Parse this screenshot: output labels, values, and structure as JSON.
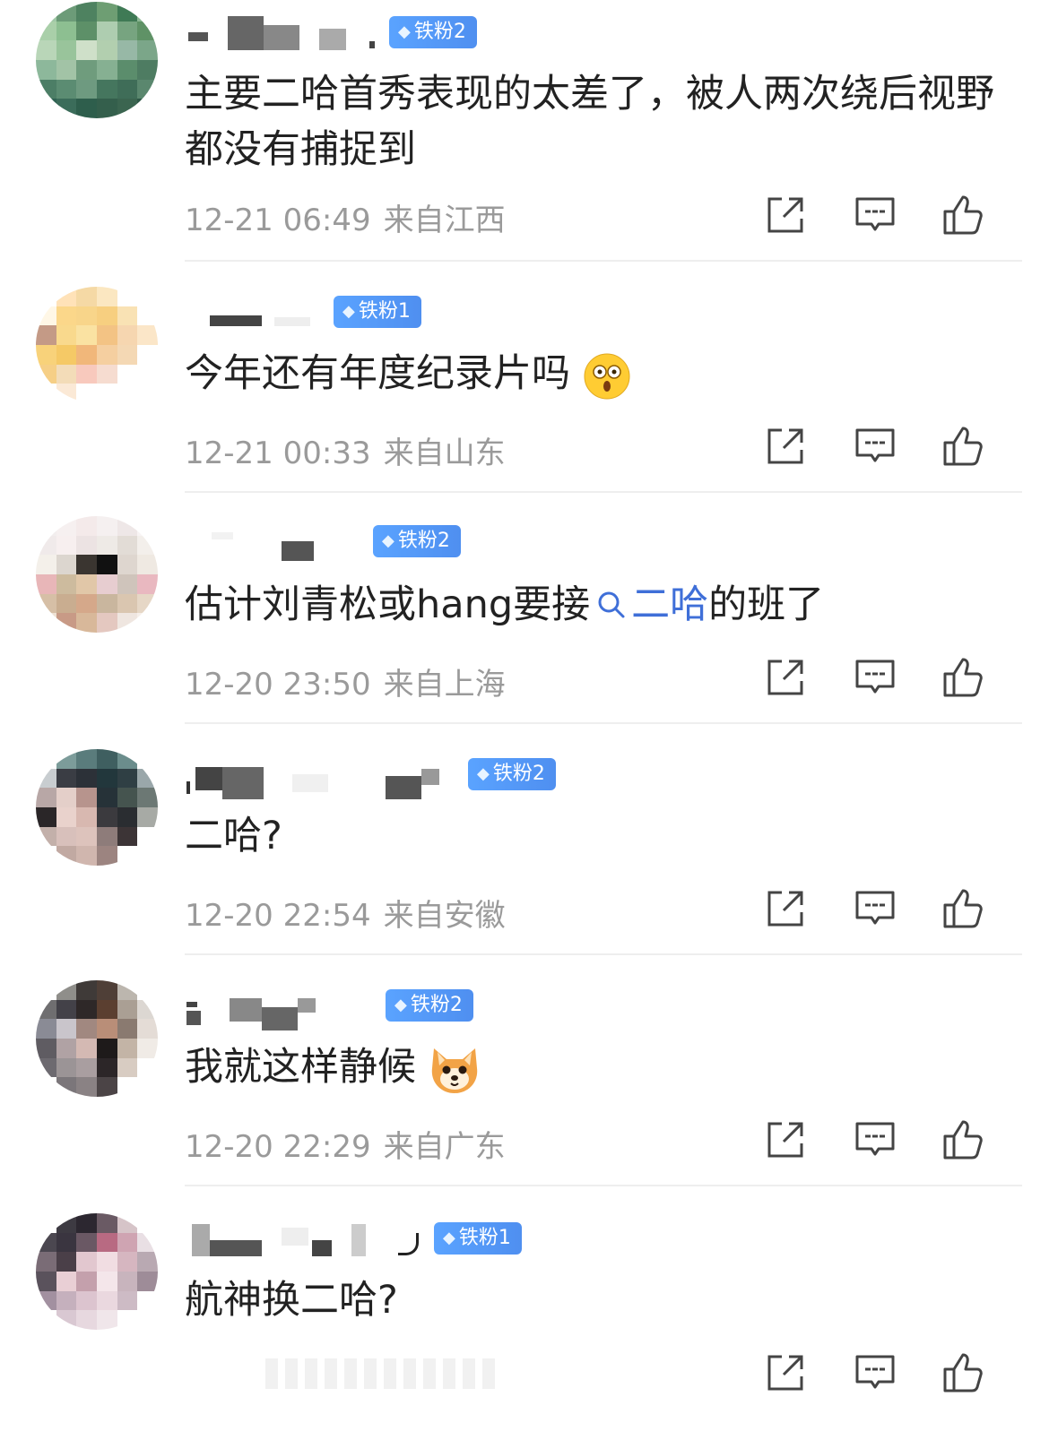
{
  "comments": [
    {
      "username": "▬▬ ▬",
      "badge": "铁粉2",
      "text": "主要二哈首秀表现的太差了，被人两次绕后视野都没有捕捉到",
      "time": "12-21 06:49",
      "location": "来自江西"
    },
    {
      "username": "▬▬",
      "badge": "铁粉1",
      "text": "今年还有年度纪录片吗",
      "emoji": "astonished-face",
      "time": "12-21 00:33",
      "location": "来自山东"
    },
    {
      "username": "▬▬",
      "badge": "铁粉2",
      "text_before": "估计刘青松或hang要接",
      "link": "二哈",
      "text_after": "的班了",
      "time": "12-20 23:50",
      "location": "来自上海"
    },
    {
      "username": "▬▬ ▬",
      "badge": "铁粉2",
      "text": "二哈?",
      "time": "12-20 22:54",
      "location": "来自安徽"
    },
    {
      "username": "▬ ▬▬",
      "badge": "铁粉2",
      "text": "我就这样静候",
      "emoji": "dog-face",
      "time": "12-20 22:29",
      "location": "来自广东"
    },
    {
      "username": "▬▬ ▬",
      "badge": "铁粉1",
      "text": "航神换二哈?",
      "time": "",
      "location": ""
    }
  ],
  "icons": {
    "share": "share-icon",
    "comment": "comment-icon",
    "like": "like-icon"
  },
  "colors": {
    "badge": "#4f8ff0",
    "link": "#3f6fd8",
    "meta": "#9a9a9a",
    "text": "#222222"
  }
}
